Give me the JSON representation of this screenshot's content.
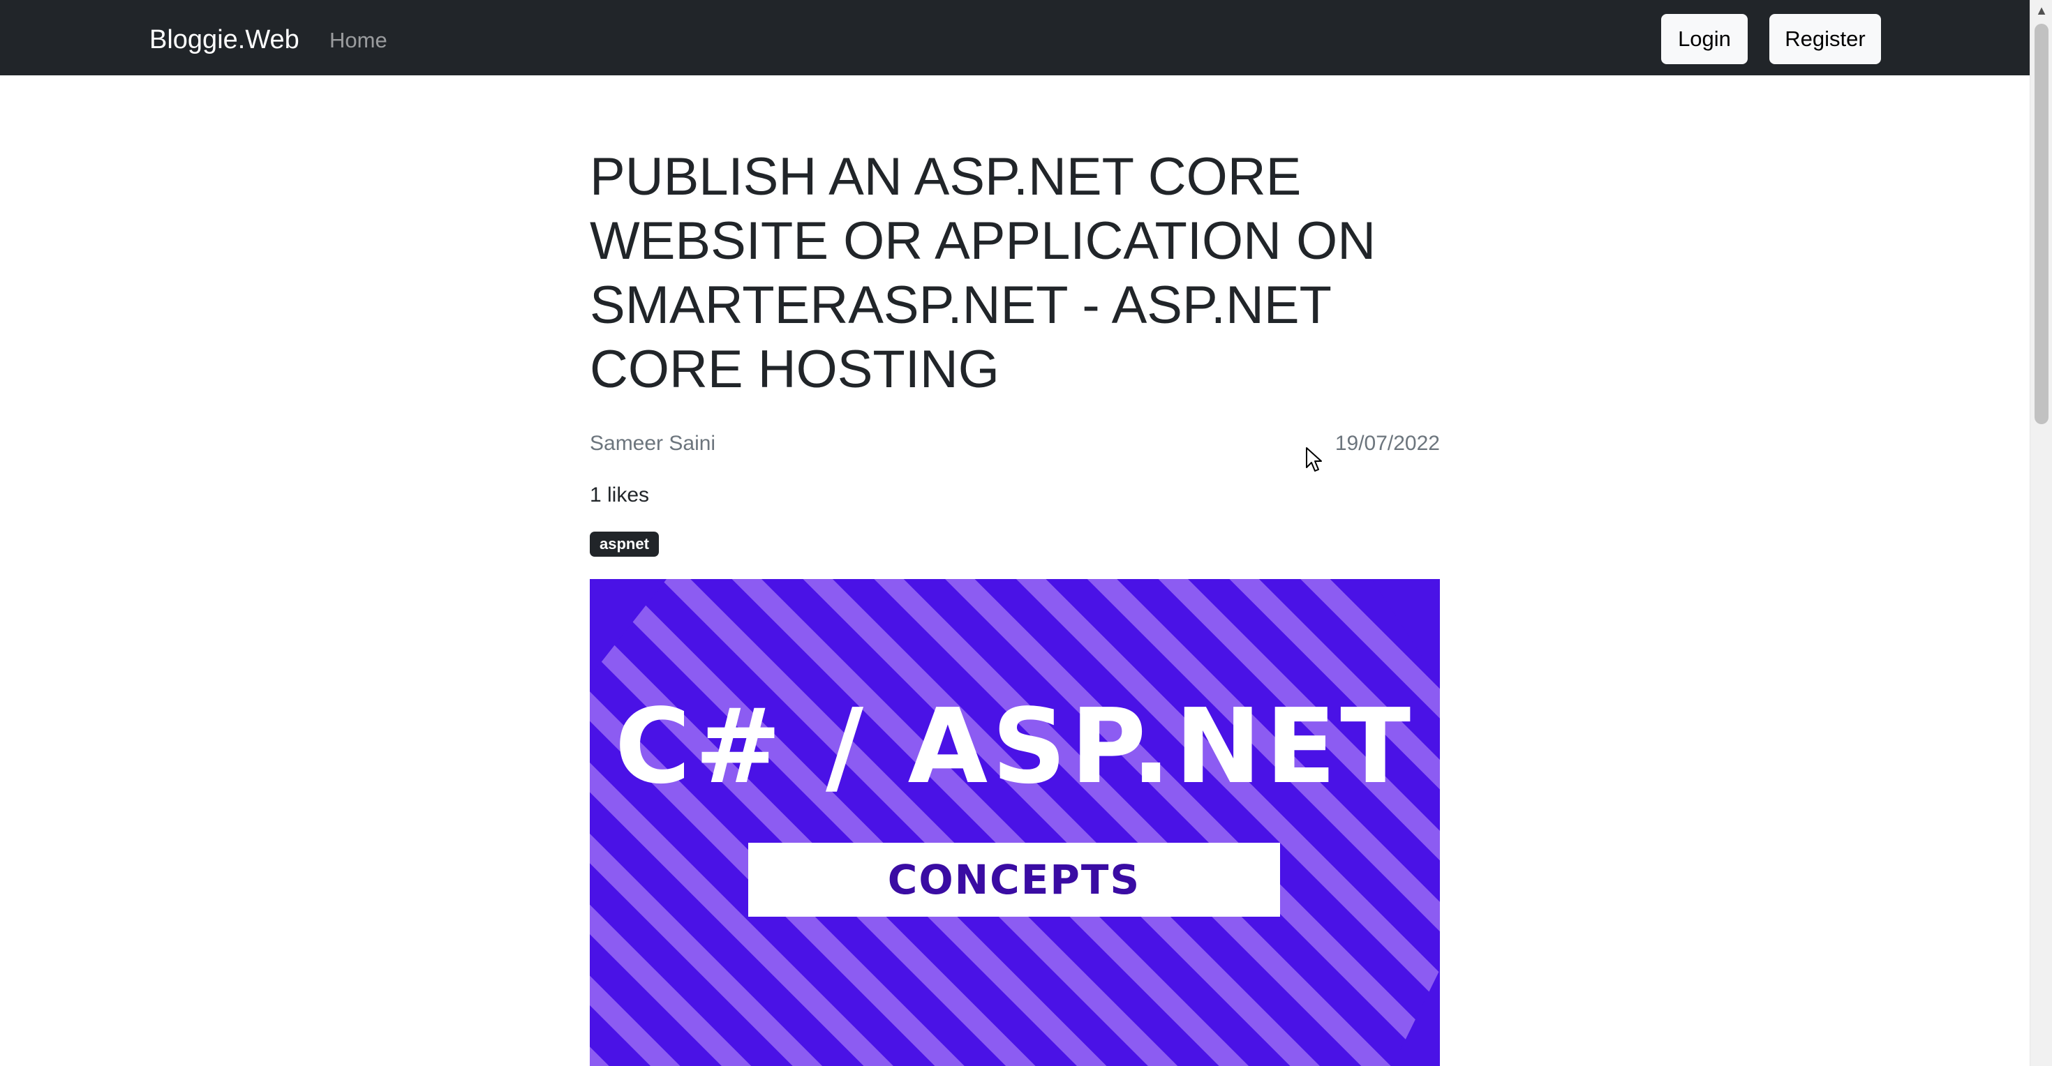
{
  "navbar": {
    "brand": "Bloggie.Web",
    "home_link": "Home",
    "login_button": "Login",
    "register_button": "Register"
  },
  "post": {
    "title": "PUBLISH AN ASP.NET CORE WEBSITE OR APPLICATION ON SMARTERASP.NET - ASP.NET CORE HOSTING",
    "author": "Sameer Saini",
    "date": "19/07/2022",
    "likes": "1 likes",
    "tag": "aspnet",
    "featured_image": {
      "heading": "C# / ASP.NET",
      "box_text": "CONCEPTS",
      "colors": {
        "background": "#4a12e6",
        "stripe": "#8c5cf2",
        "box_text": "#3a0ca3"
      }
    }
  },
  "colors": {
    "navbar_bg": "#212529",
    "button_bg": "#f8f9fa",
    "badge_bg": "#212529"
  },
  "icons": {
    "cursor": "mouse-pointer-icon",
    "scroll_up": "scroll-up-arrow-icon"
  }
}
